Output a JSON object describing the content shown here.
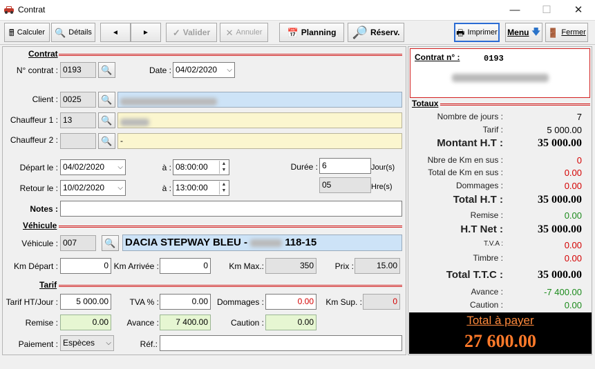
{
  "window": {
    "title": "Contrat",
    "min_icon": "minimize-icon",
    "max_icon": "maximize-icon",
    "close_icon": "close-icon"
  },
  "toolbar": {
    "calculer": "Calculer",
    "details": "Détails",
    "prev_icon": "◄",
    "next_icon": "►",
    "valider": "Valider",
    "annuler": "Annuler",
    "planning": "Planning",
    "reserv": "Réserv.",
    "imprimer": "Imprimer",
    "menu": "Menu",
    "fermer": "Fermer"
  },
  "contrat": {
    "section": "Contrat",
    "num_label": "N° contrat :",
    "num": "0193",
    "date_label": "Date :",
    "date": "04/02/2020",
    "client_label": "Client :",
    "client_code": "0025",
    "ch1_label": "Chauffeur 1 :",
    "ch1_code": "13",
    "ch2_label": "Chauffeur 2 :",
    "ch2_code": "",
    "ch2_name": "-",
    "depart_label": "Départ le :",
    "depart_date": "04/02/2020",
    "a_label": "à :",
    "depart_time": "08:00:00",
    "retour_label": "Retour le :",
    "retour_date": "10/02/2020",
    "retour_time": "13:00:00",
    "duree_label": "Durée :",
    "duree": "6",
    "jours_label": "Jour(s)",
    "heures": "05",
    "hre_label": "Hre(s)",
    "notes_label": "Notes :",
    "notes": ""
  },
  "vehicule": {
    "section": "Véhicule",
    "veh_label": "Véhicule :",
    "veh_code": "007",
    "veh_name": "DACIA STEPWAY BLEU -",
    "veh_plate_end": "118-15",
    "km_dep_label": "Km Départ :",
    "km_dep": "0",
    "km_arr_label": "Km Arrivée :",
    "km_arr": "0",
    "km_max_label": "Km Max.:",
    "km_max": "350",
    "prix_label": "Prix :",
    "prix": "15.00"
  },
  "tarif": {
    "section": "Tarif",
    "tarif_label": "Tarif HT/Jour :",
    "tarif": "5 000.00",
    "tva_label": "TVA % :",
    "tva": "0.00",
    "dom_label": "Dommages :",
    "dom": "0.00",
    "kmsup_label": "Km Sup. :",
    "kmsup": "0",
    "remise_label": "Remise :",
    "remise": "0.00",
    "avance_label": "Avance :",
    "avance": "7 400.00",
    "caution_label": "Caution :",
    "caution": "0.00",
    "paiement_label": "Paiement :",
    "paiement": "Espèces",
    "ref_label": "Réf.:",
    "ref": ""
  },
  "right": {
    "contrat_label": "Contrat n° :",
    "contrat_num": "0193",
    "totaux": "Totaux",
    "rows": [
      {
        "label": "Nombre de jours :",
        "value": "7"
      },
      {
        "label": "Tarif :",
        "value": "5 000.00"
      },
      {
        "label": "Montant H.T :",
        "value": "35 000.00"
      },
      {
        "label": "Nbre de Km en sus :",
        "value": "0"
      },
      {
        "label": "Total de Km en sus :",
        "value": "0.00"
      },
      {
        "label": "Dommages :",
        "value": "0.00"
      },
      {
        "label": "Total H.T :",
        "value": "35 000.00"
      },
      {
        "label": "Remise :",
        "value": "0.00"
      },
      {
        "label": "H.T Net :",
        "value": "35 000.00"
      },
      {
        "label": "T.V.A :",
        "value": "0.00"
      },
      {
        "label": "Timbre :",
        "value": "0.00"
      },
      {
        "label": "Total T.T.C :",
        "value": "35 000.00"
      },
      {
        "label": "Avance :",
        "value": "-7 400.00"
      },
      {
        "label": "Caution :",
        "value": "0.00"
      }
    ],
    "total_payer_label": "Total à payer",
    "total_payer": "27 600.00"
  },
  "colors": {
    "accent_red": "#d21e1e",
    "payer_label": "#ff8a3c",
    "payer_value": "#ff7a2a",
    "neg_green": "#1b8a1b"
  }
}
